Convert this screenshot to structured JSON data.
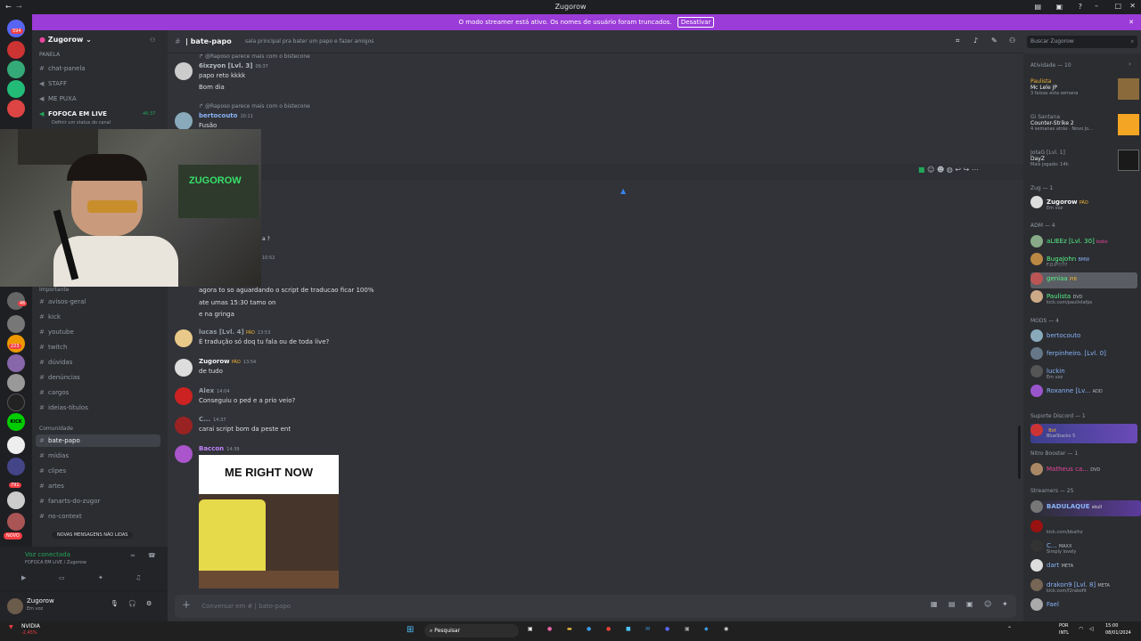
{
  "window": {
    "title": "Zugorow",
    "minimize": "–",
    "maximize": "□",
    "close": "✕"
  },
  "banner": {
    "text": "O modo streamer está ativo. Os nomes de usuário foram truncados.",
    "button": "Desativar"
  },
  "servers": {
    "badge_top": "594",
    "new_badge": "NOVO",
    "kick": "KICK",
    "counts": [
      "46",
      "223",
      "791"
    ]
  },
  "server_name": "Zugorow",
  "sidebar": {
    "panel_category": "PANELA",
    "top_channels": [
      "chat-panela",
      "STAFF",
      "ME PUXA"
    ],
    "live": {
      "label": "FOFOCA EM LIVE",
      "time": "46:37",
      "sub": "Definir um status do canal"
    },
    "important_category": "Importante",
    "important_channels": [
      "avisos-geral",
      "kick",
      "youtube",
      "twitch",
      "dúvidas",
      "denúncias",
      "cargos",
      "ideias-títulos"
    ],
    "community_category": "Comunidade",
    "community_channels": [
      "bate-papo",
      "mídias",
      "clipes",
      "artes",
      "fanarts-do-zugor",
      "no-context"
    ],
    "new_messages": "NOVAS MENSAGENS NÃO LIDAS"
  },
  "voice": {
    "status": "Voz conectada",
    "channel": "FOFOCA EM LIVE / Zugorow"
  },
  "user": {
    "name": "Zugorow",
    "status": "Em voz"
  },
  "header": {
    "channel": "| bate-papo",
    "topic": "sala principal pra bater um papo e fazer amigos",
    "search": "Buscar Zugorow"
  },
  "messages": [
    {
      "reply": "@Raposo parece mais com o bistecone",
      "author": "6ixzyon [Lvl. 3]",
      "time": "09:37",
      "lines": [
        "papo reto kkkk",
        "Bom dia"
      ]
    },
    {
      "reply": "@Raposo parece mais com o bistecone",
      "author": "bertocouto",
      "time": "10:11",
      "lines": [
        "Fusão"
      ]
    },
    {
      "author": "",
      "time": "",
      "lines": [
        "agora to so aguardando o script de traducao ficar 100%",
        "ate umas 15:30 tamo on",
        "e na gringa"
      ]
    },
    {
      "author": "lucas [Lvl. 4]",
      "badge": "PÃO",
      "time": "13:53",
      "lines": [
        "É tradução só doq tu fala ou de toda live?"
      ]
    },
    {
      "author": "Zugorow",
      "badge": "PÃO",
      "time": "13:54",
      "lines": [
        "de tudo"
      ]
    },
    {
      "author": "Alex",
      "time": "14:04",
      "lines": [
        "Conseguiu o ped e a prio veio?"
      ]
    },
    {
      "author": "C...",
      "time": "14:37",
      "lines": [
        "carai script bom da peste ent"
      ]
    },
    {
      "author": "Baccon",
      "time": "14:39",
      "lines": [],
      "image_caption": "ME RIGHT NOW"
    }
  ],
  "partial": {
    "a": "a ?",
    "b": "10:52"
  },
  "composer": {
    "placeholder": "Conversar em # | bate-papo"
  },
  "members": {
    "activity_header": "Atividade — 10",
    "activities": [
      {
        "name": "Paulista",
        "detail": "Mc Lele JP",
        "sub": "3 faixas esta semana"
      },
      {
        "name": "Gi Santana",
        "detail": "Counter-Strike 2",
        "sub": "4 semanas atrás · Novo Jo..."
      },
      {
        "name": "JotaG [Lvl. 1]",
        "detail": "DayZ",
        "sub": "Mais jogado: 14h"
      }
    ],
    "groups": [
      {
        "title": "Zug — 1",
        "items": [
          {
            "name": "Zugorow",
            "sub": "Em voz",
            "badge": "PÃO"
          }
        ]
      },
      {
        "title": "ADM — 4",
        "items": [
          {
            "name": "aLIEEz [Lvl. 30]",
            "sub": "",
            "badge": "bobo"
          },
          {
            "name": "BugaJohn",
            "sub": "F.O.P!!!??",
            "badge": "BMW"
          },
          {
            "name": "geniaa",
            "sub": "",
            "badge": "PIB"
          },
          {
            "name": "Paulista",
            "sub": "kick.com/paulistafps",
            "badge": "DVD"
          }
        ]
      },
      {
        "title": "MODS — 4",
        "items": [
          {
            "name": "bertocouto",
            "sub": "",
            "badge": ""
          },
          {
            "name": "ferpinheiro. [Lvl. 0]",
            "sub": "",
            "badge": ""
          },
          {
            "name": "luckin",
            "sub": "Em voz",
            "badge": ""
          },
          {
            "name": "Roxanne [Lv...",
            "sub": "",
            "badge": "ADD"
          }
        ]
      },
      {
        "title": "Suporte Discord — 1",
        "items": [
          {
            "name": "",
            "sub": "BlueStacks 5",
            "badge": "Bot"
          }
        ]
      },
      {
        "title": "Nitro Booster — 1",
        "items": [
          {
            "name": "Matheus ca...",
            "sub": "",
            "badge": "DVD"
          }
        ]
      },
      {
        "title": "Streamers — 25",
        "items": [
          {
            "name": "BADULAQUE",
            "sub": "",
            "badge": "skull"
          },
          {
            "name": "",
            "sub": "kick.com/bbalhz",
            "badge": ""
          },
          {
            "name": "C...",
            "sub": "Simply lovely",
            "badge": "MAXX"
          },
          {
            "name": "dart",
            "sub": "",
            "badge": "META"
          },
          {
            "name": "drakon9 [Lvl. 8]",
            "sub": "kick.com/f2rakofit",
            "badge": "META"
          },
          {
            "name": "Fael",
            "sub": "",
            "badge": ""
          }
        ]
      }
    ]
  },
  "taskbar": {
    "stock": "NVIDIA",
    "stock_change": "-2,45%",
    "search": "Pesquisar",
    "lang1": "POR",
    "lang2": "INTL",
    "time": "15:00",
    "date": "08/01/2024"
  },
  "colors": {
    "accent": "#9b3bd8",
    "bg": "#313338",
    "sidebar": "#2b2d31",
    "green": "#23a55a",
    "pink": "#eb459e"
  }
}
